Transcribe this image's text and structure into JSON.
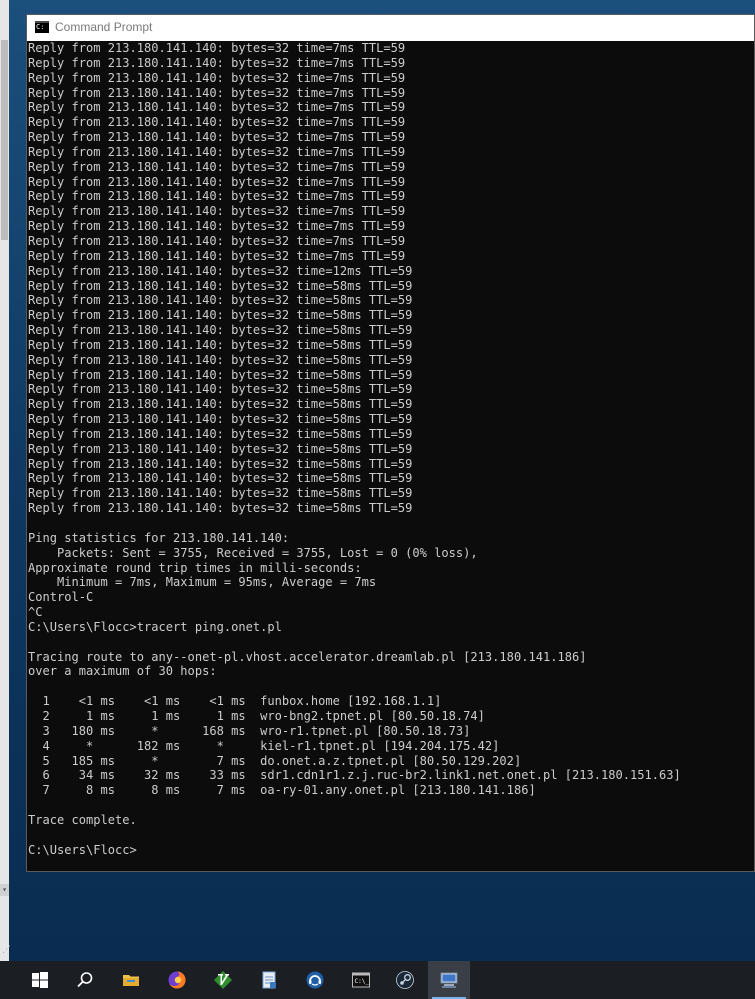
{
  "window": {
    "title": "Command Prompt"
  },
  "console": {
    "lines": [
      "Reply from 213.180.141.140: bytes=32 time=7ms TTL=59",
      "Reply from 213.180.141.140: bytes=32 time=7ms TTL=59",
      "Reply from 213.180.141.140: bytes=32 time=7ms TTL=59",
      "Reply from 213.180.141.140: bytes=32 time=7ms TTL=59",
      "Reply from 213.180.141.140: bytes=32 time=7ms TTL=59",
      "Reply from 213.180.141.140: bytes=32 time=7ms TTL=59",
      "Reply from 213.180.141.140: bytes=32 time=7ms TTL=59",
      "Reply from 213.180.141.140: bytes=32 time=7ms TTL=59",
      "Reply from 213.180.141.140: bytes=32 time=7ms TTL=59",
      "Reply from 213.180.141.140: bytes=32 time=7ms TTL=59",
      "Reply from 213.180.141.140: bytes=32 time=7ms TTL=59",
      "Reply from 213.180.141.140: bytes=32 time=7ms TTL=59",
      "Reply from 213.180.141.140: bytes=32 time=7ms TTL=59",
      "Reply from 213.180.141.140: bytes=32 time=7ms TTL=59",
      "Reply from 213.180.141.140: bytes=32 time=7ms TTL=59",
      "Reply from 213.180.141.140: bytes=32 time=12ms TTL=59",
      "Reply from 213.180.141.140: bytes=32 time=58ms TTL=59",
      "Reply from 213.180.141.140: bytes=32 time=58ms TTL=59",
      "Reply from 213.180.141.140: bytes=32 time=58ms TTL=59",
      "Reply from 213.180.141.140: bytes=32 time=58ms TTL=59",
      "Reply from 213.180.141.140: bytes=32 time=58ms TTL=59",
      "Reply from 213.180.141.140: bytes=32 time=58ms TTL=59",
      "Reply from 213.180.141.140: bytes=32 time=58ms TTL=59",
      "Reply from 213.180.141.140: bytes=32 time=58ms TTL=59",
      "Reply from 213.180.141.140: bytes=32 time=58ms TTL=59",
      "Reply from 213.180.141.140: bytes=32 time=58ms TTL=59",
      "Reply from 213.180.141.140: bytes=32 time=58ms TTL=59",
      "Reply from 213.180.141.140: bytes=32 time=58ms TTL=59",
      "Reply from 213.180.141.140: bytes=32 time=58ms TTL=59",
      "Reply from 213.180.141.140: bytes=32 time=58ms TTL=59",
      "Reply from 213.180.141.140: bytes=32 time=58ms TTL=59",
      "Reply from 213.180.141.140: bytes=32 time=58ms TTL=59",
      "",
      "Ping statistics for 213.180.141.140:",
      "    Packets: Sent = 3755, Received = 3755, Lost = 0 (0% loss),",
      "Approximate round trip times in milli-seconds:",
      "    Minimum = 7ms, Maximum = 95ms, Average = 7ms",
      "Control-C",
      "^C",
      "C:\\Users\\Flocc>tracert ping.onet.pl",
      "",
      "Tracing route to any--onet-pl.vhost.accelerator.dreamlab.pl [213.180.141.186]",
      "over a maximum of 30 hops:",
      "",
      "  1    <1 ms    <1 ms    <1 ms  funbox.home [192.168.1.1]",
      "  2     1 ms     1 ms     1 ms  wro-bng2.tpnet.pl [80.50.18.74]",
      "  3   180 ms     *      168 ms  wro-r1.tpnet.pl [80.50.18.73]",
      "  4     *      182 ms     *     kiel-r1.tpnet.pl [194.204.175.42]",
      "  5   185 ms     *        7 ms  do.onet.a.z.tpnet.pl [80.50.129.202]",
      "  6    34 ms    32 ms    33 ms  sdr1.cdn1r1.z.j.ruc-br2.link1.net.onet.pl [213.180.151.63]",
      "  7     8 ms     8 ms     7 ms  oa-ry-01.any.onet.pl [213.180.141.186]",
      "",
      "Trace complete.",
      "",
      "C:\\Users\\Flocc>"
    ]
  },
  "taskbar": {
    "items": [
      {
        "name": "start-button",
        "icon": "windows-logo-icon"
      },
      {
        "name": "search-button",
        "icon": "search-icon"
      },
      {
        "name": "file-explorer-button",
        "icon": "folder-icon"
      },
      {
        "name": "firefox-button",
        "icon": "firefox-icon"
      },
      {
        "name": "vim-button",
        "icon": "vim-icon"
      },
      {
        "name": "notepad-button",
        "icon": "notepad-icon"
      },
      {
        "name": "teamspeak-button",
        "icon": "teamspeak-icon"
      },
      {
        "name": "cmd-button",
        "icon": "terminal-icon"
      },
      {
        "name": "steam-button",
        "icon": "steam-icon"
      },
      {
        "name": "network-app-button",
        "icon": "network-icon"
      }
    ]
  },
  "colors": {
    "console_bg": "#0c0c0c",
    "console_text": "#cccccc",
    "taskbar_bg": "#1b1f24"
  }
}
